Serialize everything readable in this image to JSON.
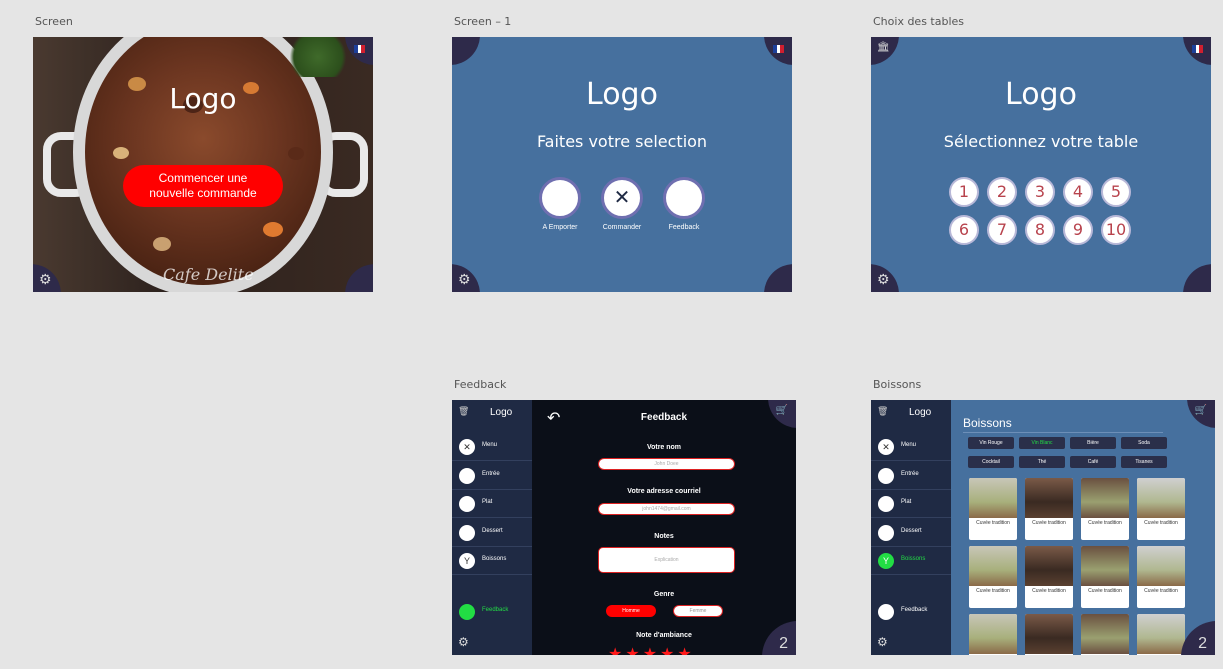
{
  "artboards": {
    "screen": {
      "label": "Screen",
      "logo": "Logo",
      "cta": "Commencer une nouvelle commande"
    },
    "screen1": {
      "label": "Screen – 1",
      "logo": "Logo",
      "subtitle": "Faites votre selection",
      "options": [
        "A Emporter",
        "Commander",
        "Feedback"
      ]
    },
    "tables": {
      "label": "Choix des tables",
      "logo": "Logo",
      "subtitle": "Sélectionnez votre table",
      "numbers": [
        "1",
        "2",
        "3",
        "4",
        "5",
        "6",
        "7",
        "8",
        "9",
        "10"
      ]
    },
    "feedback": {
      "label": "Feedback",
      "logo": "Logo",
      "title": "Feedback",
      "name_label": "Votre nom",
      "name_placeholder": "John Doee",
      "email_label": "Votre adresse courriel",
      "email_placeholder": "john1474@gmail.com",
      "notes_label": "Notes",
      "notes_placeholder": "Explication",
      "genre_label": "Genre",
      "genre_options": [
        "Homme",
        "Femme"
      ],
      "ambiance_label": "Note d'ambiance",
      "badge": "2"
    },
    "boissons": {
      "label": "Boissons",
      "logo": "Logo",
      "title": "Boissons",
      "filters": [
        "Vin Rouge",
        "Vin Blanc",
        "Bière",
        "Soda",
        "Cocktail",
        "Thé",
        "Café",
        "Tisanes"
      ],
      "card_title": "Cuvée tradition",
      "badge": "2"
    }
  },
  "sidebar": {
    "items": [
      "Menu",
      "Entrée",
      "Plat",
      "Dessert",
      "Boissons",
      "Feedback"
    ]
  },
  "colors": {
    "canvas": "#e5e5e5",
    "blue_panel": "#46709e",
    "dark_corner": "#2e2a4a",
    "sidebar": "#1f2a44",
    "accent_red": "#ff0000",
    "accent_green": "#22dd44"
  }
}
